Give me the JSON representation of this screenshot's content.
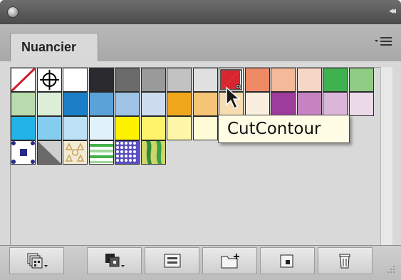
{
  "panel": {
    "tab_label": "Nuancier",
    "menu_icon": "panel-menu-icon",
    "tooltip": "CutContour"
  },
  "swatches": [
    {
      "name": "none",
      "kind": "none"
    },
    {
      "name": "registration",
      "kind": "registration"
    },
    {
      "name": "white",
      "color": "#ffffff"
    },
    {
      "name": "black",
      "color": "#2b2b2f"
    },
    {
      "name": "gray-75",
      "color": "#6b6b6b"
    },
    {
      "name": "gray-50",
      "color": "#9a9a9a"
    },
    {
      "name": "gray-25",
      "color": "#c2c2c2"
    },
    {
      "name": "gray-10",
      "color": "#e0e0e0"
    },
    {
      "name": "cutcontour",
      "kind": "spot",
      "color": "#d9262e"
    },
    {
      "name": "orange-salmon",
      "color": "#ee8a66"
    },
    {
      "name": "peach",
      "color": "#f4b999"
    },
    {
      "name": "light-peach",
      "color": "#f6d7c6"
    },
    {
      "name": "green",
      "color": "#3fb14e"
    },
    {
      "name": "light-green",
      "color": "#8fcb83"
    },
    {
      "name": "pale-green",
      "color": "#b9dcae"
    },
    {
      "name": "mint-white",
      "color": "#dcedd8"
    },
    {
      "name": "blue",
      "color": "#1a7fc6"
    },
    {
      "name": "sky-blue",
      "color": "#5aa2d8"
    },
    {
      "name": "light-blue",
      "color": "#9ec3e6"
    },
    {
      "name": "pale-blue",
      "color": "#cdddef"
    },
    {
      "name": "amber",
      "color": "#f0a71c"
    },
    {
      "name": "light-amber",
      "color": "#f5c475"
    },
    {
      "name": "cream",
      "color": "#f7dcb1"
    },
    {
      "name": "cream-light",
      "color": "#faeedf"
    },
    {
      "name": "purple",
      "color": "#9d3c9a"
    },
    {
      "name": "orchid",
      "color": "#c583c1"
    },
    {
      "name": "lilac",
      "color": "#dcb6d9"
    },
    {
      "name": "pale-lilac",
      "color": "#ecdaea"
    },
    {
      "name": "cyan",
      "color": "#22b4e8"
    },
    {
      "name": "light-cyan",
      "color": "#85cdef"
    },
    {
      "name": "pale-cyan",
      "color": "#bde2f5"
    },
    {
      "name": "ice",
      "color": "#e0f1fa"
    },
    {
      "name": "yellow",
      "color": "#fff200"
    },
    {
      "name": "light-yellow",
      "color": "#fff36c"
    },
    {
      "name": "pale-yellow",
      "color": "#fff7a8"
    },
    {
      "name": "ivory",
      "color": "#fffbd6"
    },
    {
      "name": "pattern-dots-blue",
      "kind": "pattern1"
    },
    {
      "name": "pattern-triangles",
      "kind": "pattern2"
    },
    {
      "name": "pattern-stars",
      "kind": "pattern3"
    },
    {
      "name": "pattern-stripes-green",
      "kind": "pattern4"
    },
    {
      "name": "pattern-dots-grid",
      "kind": "pattern5"
    },
    {
      "name": "pattern-foliage",
      "kind": "pattern6"
    }
  ],
  "bottom_buttons": [
    {
      "name": "swatch-library-menu-button",
      "icon": "libraries-icon"
    },
    {
      "name": "show-swatch-kinds-button",
      "icon": "swatch-kinds-icon"
    },
    {
      "name": "swatch-options-button",
      "icon": "swatch-options-icon"
    },
    {
      "name": "new-color-group-button",
      "icon": "new-group-icon"
    },
    {
      "name": "new-swatch-button",
      "icon": "new-swatch-icon"
    },
    {
      "name": "delete-swatch-button",
      "icon": "trash-icon"
    }
  ]
}
